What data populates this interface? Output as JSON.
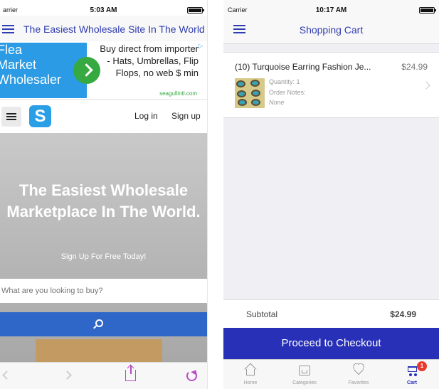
{
  "left_screen": {
    "status_bar": {
      "carrier": "arrier",
      "time": "5:03 AM"
    },
    "nav": {
      "title": "The Easiest Wholesale Site In The World"
    },
    "ad": {
      "image_lines": [
        "Flea",
        "Market",
        "Wholesaler"
      ],
      "text": "Buy direct from importer - Hats, Umbrellas, Flip Flops, no web $ min",
      "url": "seagullintl.com"
    },
    "site_header": {
      "logo_letter": "S",
      "login": "Log in",
      "signup": "Sign up"
    },
    "hero": {
      "headline": "The Easiest Wholesale Marketplace In The World.",
      "subline": "Sign Up For Free Today!",
      "search_placeholder": "What are you looking to buy?"
    },
    "toolbar": {}
  },
  "right_screen": {
    "status_bar": {
      "carrier": "Carrier",
      "time": "10:17 AM"
    },
    "nav": {
      "title": "Shopping Cart"
    },
    "cart_item": {
      "name": "(10) Turquoise Earring Fashion Je...",
      "price": "$24.99",
      "quantity": "Quantity: 1",
      "order_notes_label": "Order Notes:",
      "order_notes_value": "None"
    },
    "subtotal": {
      "label": "Subtotal",
      "value": "$24.99"
    },
    "checkout_label": "Proceed to Checkout",
    "tabs": [
      {
        "label": "Home",
        "icon": "home-icon"
      },
      {
        "label": "Categories",
        "icon": "categories-icon"
      },
      {
        "label": "Favorites",
        "icon": "heart-icon"
      },
      {
        "label": "Cart",
        "icon": "cart-icon",
        "badge": "1",
        "active": true
      }
    ]
  },
  "colors": {
    "nav_title": "#2f3db0",
    "checkout_bg": "#2830b8",
    "search_button": "#2f67c8",
    "ad_blue": "#2a9be4",
    "ad_green": "#37a941",
    "badge_red": "#e8392b"
  }
}
